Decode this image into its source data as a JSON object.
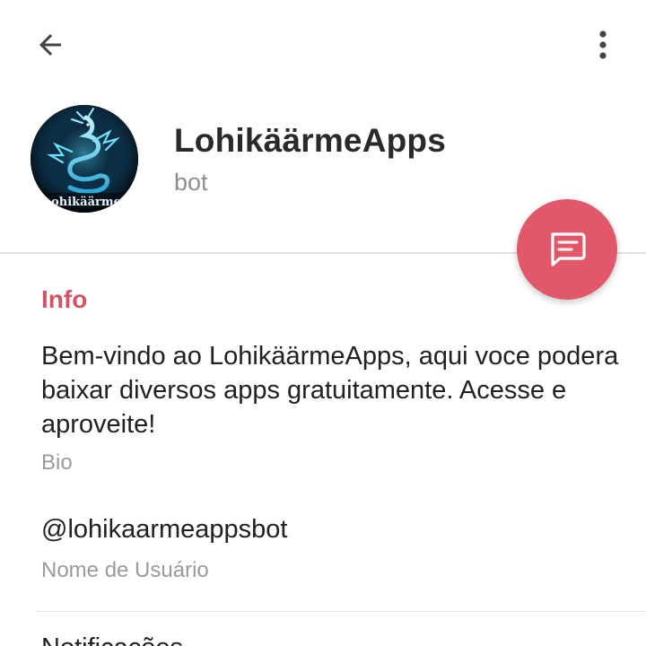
{
  "topbar": {
    "back_icon": "arrow-left-icon",
    "more_icon": "more-vertical-icon"
  },
  "profile": {
    "name": "LohikäärmeApps",
    "status": "bot",
    "avatar_text": "ohikäärme",
    "avatar_icon": "dragon-logo"
  },
  "fab": {
    "icon": "message-icon",
    "color": "#e0586a"
  },
  "info": {
    "title": "Info",
    "title_color": "#d35565",
    "bio_text": "Bem-vindo ao LohikäärmeApps, aqui voce podera baixar diversos apps gratuitamente. Acesse e aproveite!",
    "bio_label": "Bio",
    "username": "@lohikaarmeappsbot",
    "username_label": "Nome de Usuário",
    "next_item": "Notificações"
  }
}
